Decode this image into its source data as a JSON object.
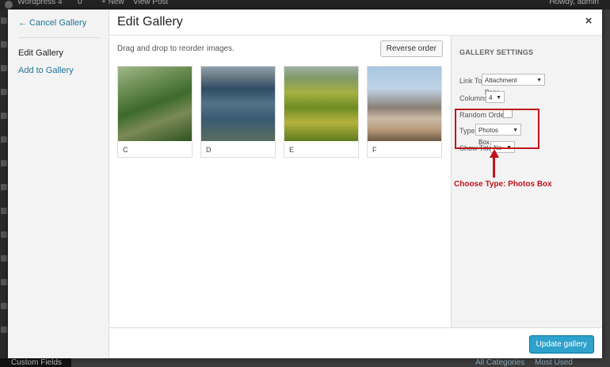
{
  "admin_bar": {
    "site_name": "Wordpress 4",
    "comments_count": "0",
    "new_label": "+ New",
    "view_post": "View Post",
    "howdy": "Howdy, admin"
  },
  "background": {
    "custom_fields": "Custom Fields",
    "all_categories": "All Categories",
    "most_used": "Most Used"
  },
  "sidebar": {
    "cancel_link": "← Cancel Gallery",
    "items": [
      {
        "label": "Edit Gallery"
      },
      {
        "label": "Add to Gallery"
      }
    ]
  },
  "header": {
    "title": "Edit Gallery",
    "close": "×"
  },
  "content": {
    "instructions": "Drag and drop to reorder images.",
    "reverse_button": "Reverse order",
    "images": [
      {
        "caption": "C"
      },
      {
        "caption": "D"
      },
      {
        "caption": "E"
      },
      {
        "caption": "F"
      }
    ]
  },
  "settings": {
    "heading": "GALLERY SETTINGS",
    "link_to": {
      "label": "Link To",
      "value": "Attachment Page"
    },
    "columns": {
      "label": "Columns",
      "value": "4"
    },
    "random_order": {
      "label": "Random Order",
      "checked": false
    },
    "type": {
      "label": "Type",
      "value": "Photos Box"
    },
    "show_title": {
      "label": "Show Title",
      "value": "No"
    }
  },
  "annotation": {
    "text": "Choose Type: Photos Box",
    "color": "#c0141a"
  },
  "footer": {
    "update_button": "Update gallery"
  },
  "colors": {
    "accent": "#2ea2cc",
    "link": "#21759b"
  }
}
